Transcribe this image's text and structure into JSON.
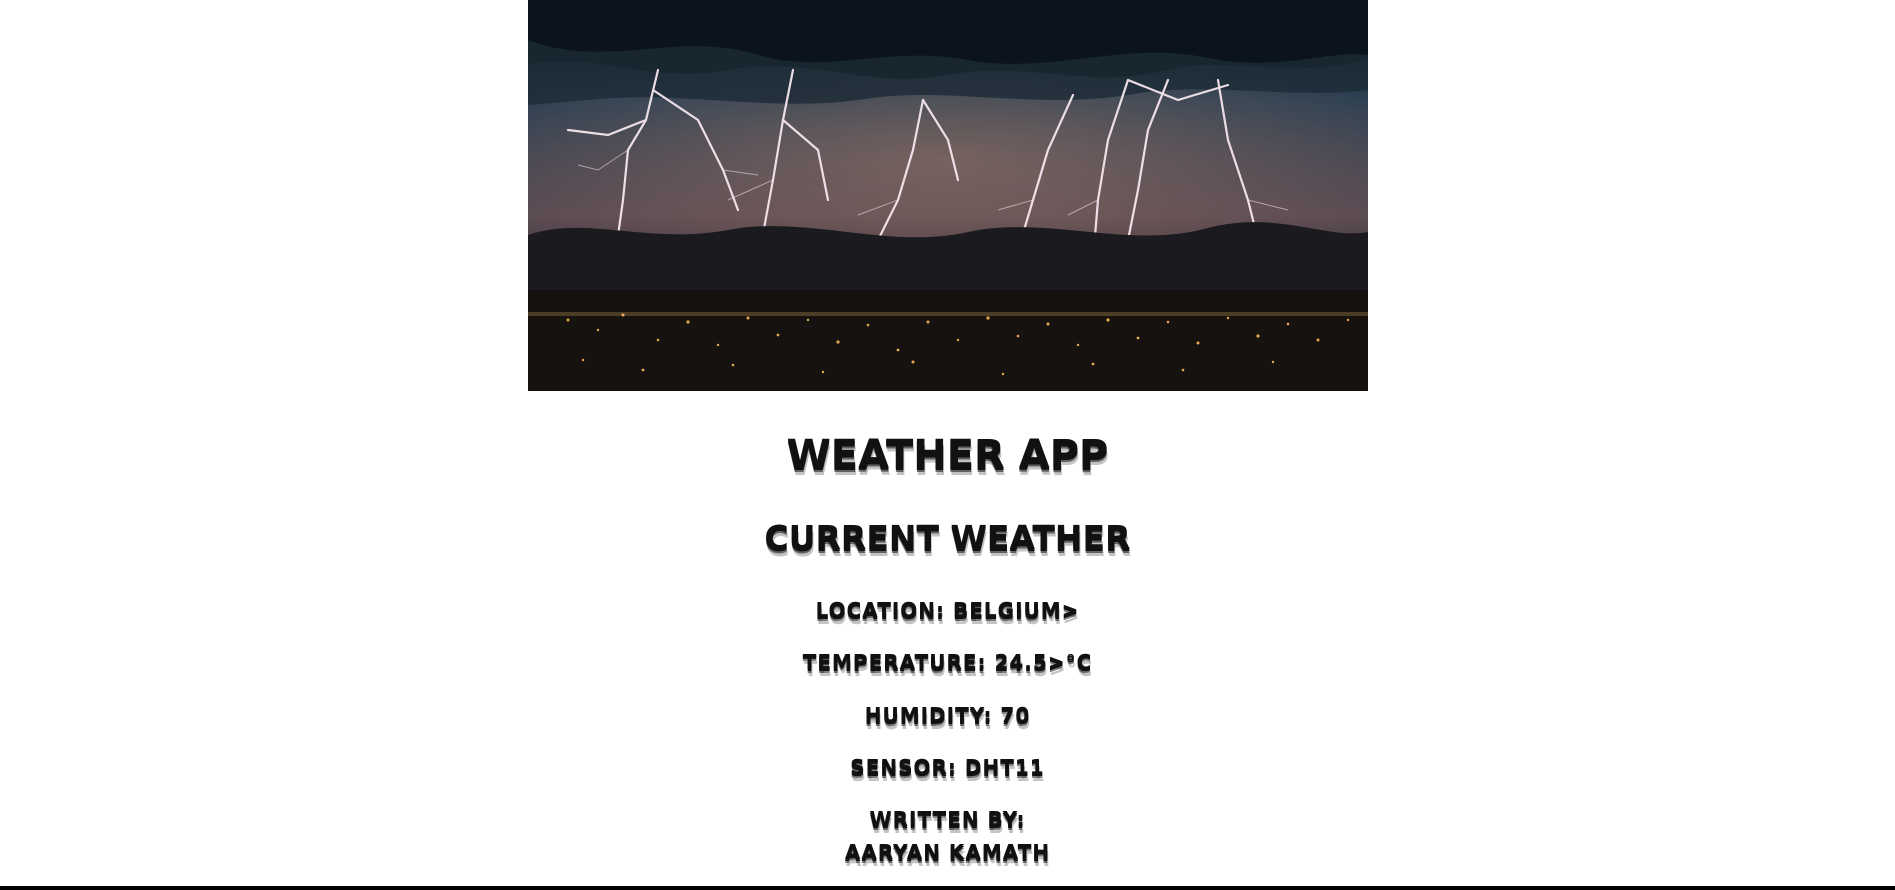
{
  "header_image": {
    "subject": "lightning storm over city at night",
    "colors": {
      "sky": "#1e2c3a",
      "cloud": "#0f1a24",
      "glow": "#8a6a62",
      "city": "#1a1612",
      "lights": "#e0a24a"
    }
  },
  "title": "WEATHER APP",
  "subtitle": "CURRENT WEATHER",
  "readings": {
    "location": "LOCATION: BELGIUM>",
    "temperature": "TEMPERATURE: 24.5>°C",
    "humidity": "HUMIDITY: 70",
    "sensor": "SENSOR: DHT11"
  },
  "credits": {
    "label": "WRITTEN BY:",
    "author": "AARYAN KAMATH"
  }
}
